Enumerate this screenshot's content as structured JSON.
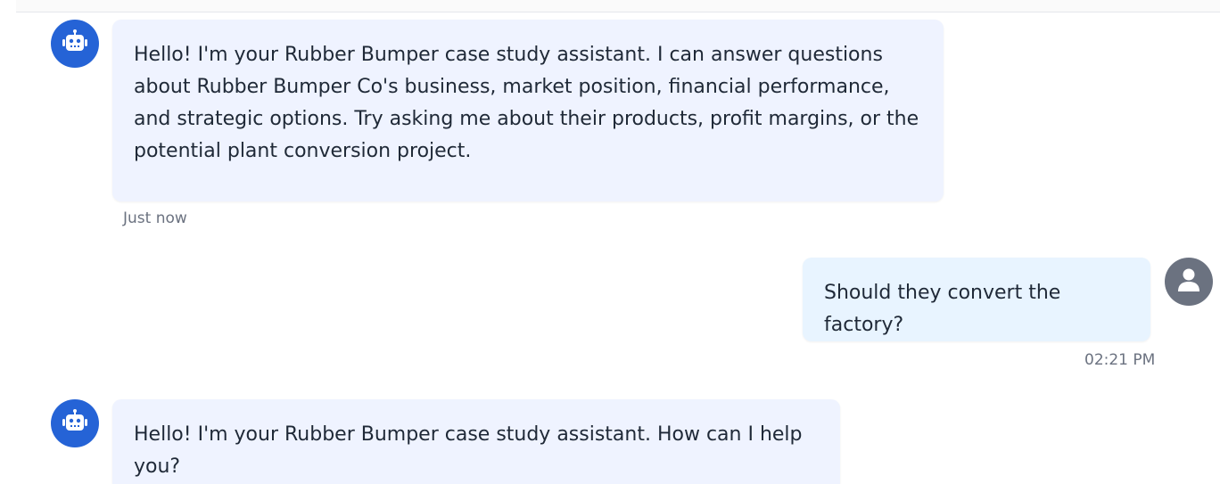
{
  "messages": [
    {
      "role": "assistant",
      "avatar_icon": "robot-icon",
      "text": "Hello! I'm your Rubber Bumper case study assistant. I can answer questions about Rubber Bumper Co's business, market position, financial performance, and strategic options. Try asking me about their products, profit margins, or the potential plant conversion project.",
      "timestamp": "Just now"
    },
    {
      "role": "user",
      "avatar_icon": "user-icon",
      "text": "Should they convert the factory?",
      "timestamp": "02:21 PM"
    },
    {
      "role": "assistant",
      "avatar_icon": "robot-icon",
      "text": "Hello! I'm your Rubber Bumper case study assistant. How can I help you?",
      "timestamp": ""
    }
  ],
  "colors": {
    "bot_avatar": "#2563d6",
    "user_avatar": "#6b7280",
    "bot_bubble": "#eff3ff",
    "user_bubble": "#e8f4ff"
  }
}
